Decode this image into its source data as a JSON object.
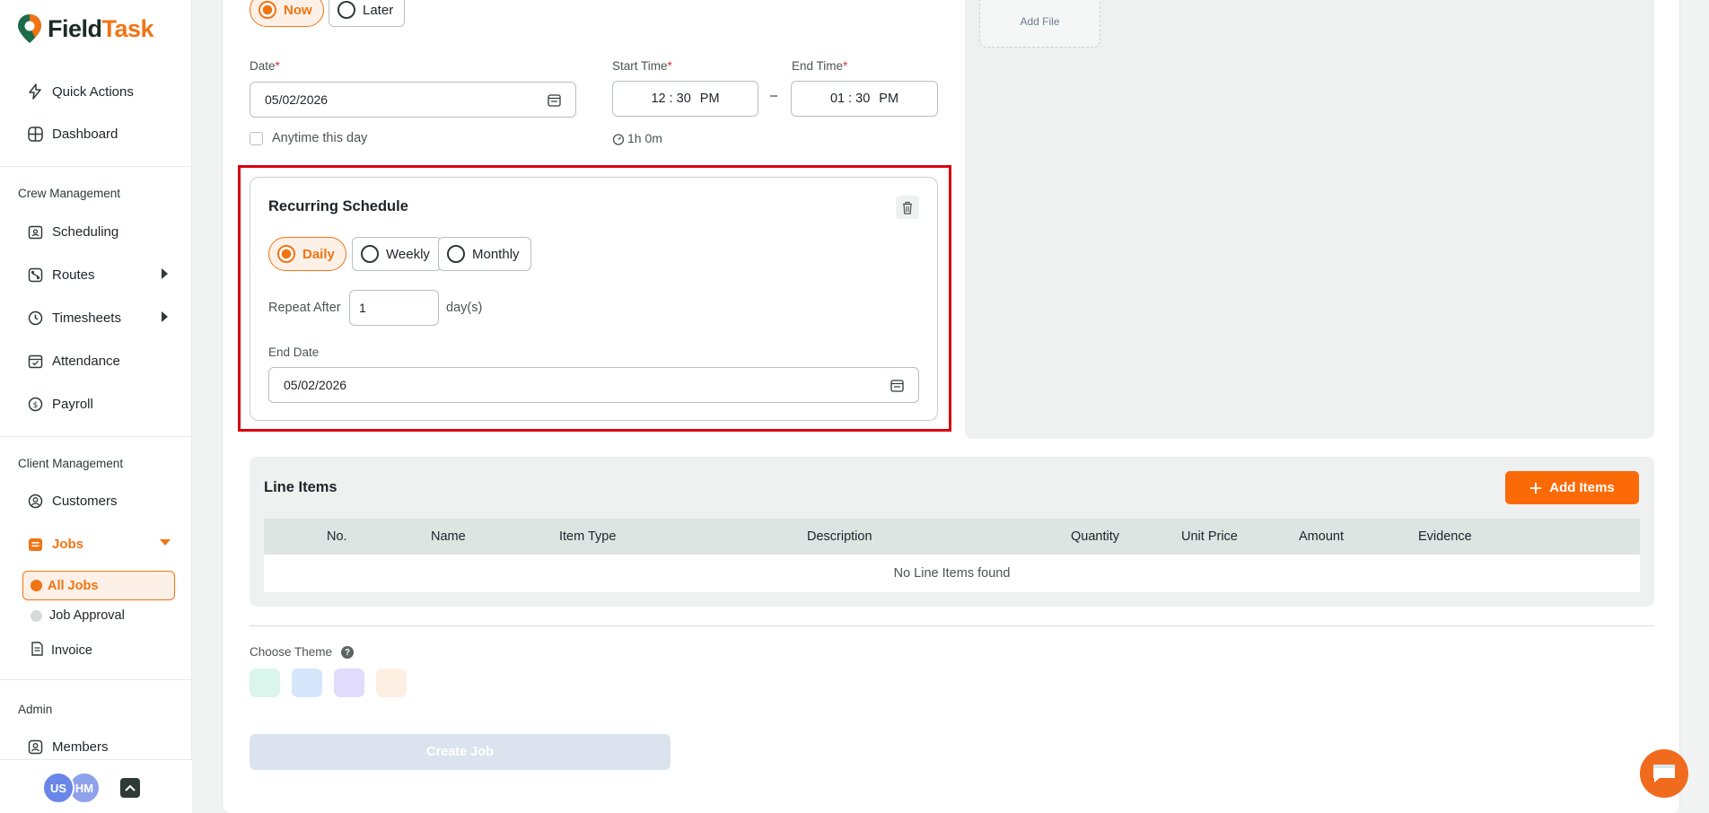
{
  "app": {
    "brand_part1": "Field",
    "brand_part2": "Task"
  },
  "sidebar": {
    "top_items": [
      {
        "label": "Quick Actions",
        "icon": "bolt-icon"
      },
      {
        "label": "Dashboard",
        "icon": "grid-icon"
      }
    ],
    "crew_section": "Crew Management",
    "crew_items": [
      {
        "label": "Scheduling",
        "icon": "calendar-user-icon"
      },
      {
        "label": "Routes",
        "icon": "route-icon"
      },
      {
        "label": "Timesheets",
        "icon": "clock-icon"
      },
      {
        "label": "Attendance",
        "icon": "calendar-check-icon"
      },
      {
        "label": "Payroll",
        "icon": "dollar-icon"
      }
    ],
    "client_section": "Client Management",
    "client_items": [
      {
        "label": "Customers",
        "icon": "user-circle-icon"
      },
      {
        "label": "Jobs",
        "icon": "briefcase-icon"
      }
    ],
    "jobs_sub": [
      {
        "label": "All Jobs"
      },
      {
        "label": "Job Approval"
      },
      {
        "label": "Invoice"
      }
    ],
    "admin_section": "Admin",
    "admin_items": [
      {
        "label": "Members",
        "icon": "user-icon"
      }
    ],
    "avatars": [
      {
        "initials": "US",
        "color": "#6a86e8"
      },
      {
        "initials": "HM",
        "color": "#8ea2ec"
      }
    ]
  },
  "schedule": {
    "when_options": [
      "Now",
      "Later"
    ],
    "date_label": "Date",
    "date_value": "05/02/2026",
    "start_label": "Start Time",
    "start_hour": "12",
    "start_min": "30",
    "start_ampm": "PM",
    "end_label": "End Time",
    "end_hour": "01",
    "end_min": "30",
    "end_ampm": "PM",
    "dash": "–",
    "anytime_label": "Anytime this day",
    "duration": "1h 0m",
    "add_file": "Add File"
  },
  "recurring": {
    "title": "Recurring Schedule",
    "options": [
      "Daily",
      "Weekly",
      "Monthly"
    ],
    "repeat_label": "Repeat After",
    "repeat_value": "1",
    "repeat_unit": "day(s)",
    "end_date_label": "End Date",
    "end_date_value": "05/02/2026"
  },
  "line_items": {
    "title": "Line Items",
    "add_button": "Add Items",
    "columns": [
      "No.",
      "Name",
      "Item Type",
      "Description",
      "Quantity",
      "Unit Price",
      "Amount",
      "Evidence"
    ],
    "empty_text": "No Line Items found"
  },
  "theme": {
    "label": "Choose Theme",
    "help": "?",
    "swatches": [
      "#d9f5ec",
      "#d6e6fb",
      "#e1dcfb",
      "#fdf0e3"
    ]
  },
  "create_button": "Create Job",
  "colors": {
    "accent": "#f07414",
    "highlight_outline": "#d9000e"
  }
}
